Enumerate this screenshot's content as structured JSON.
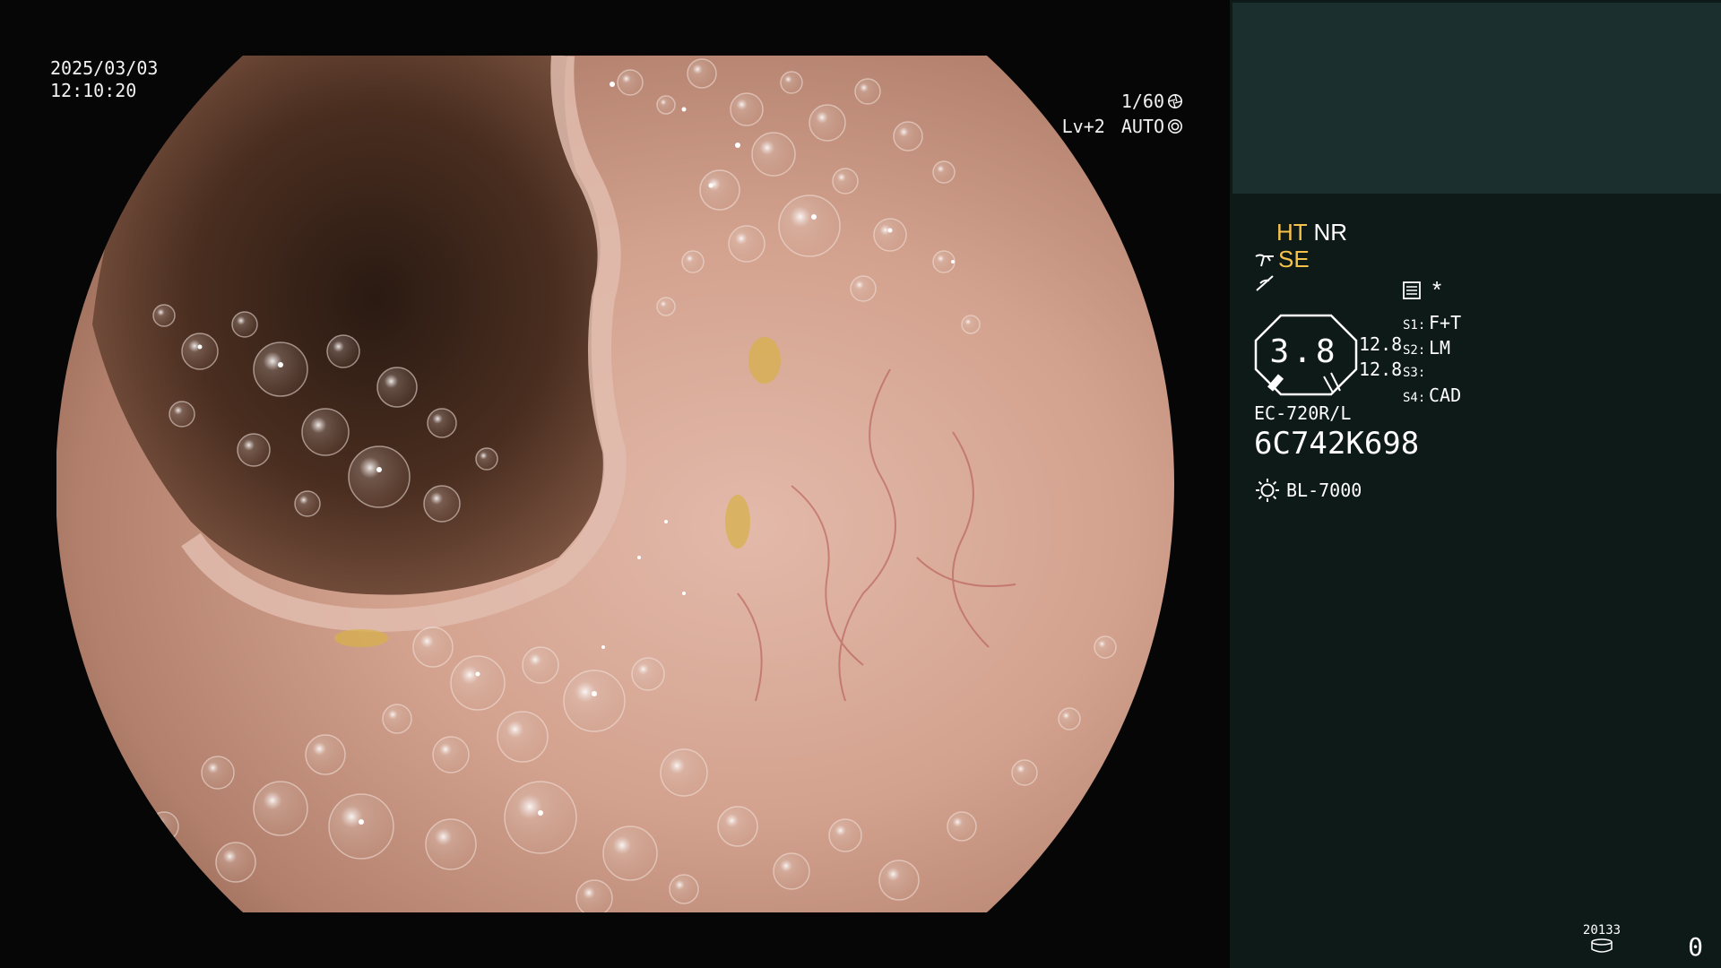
{
  "video": {
    "date": "2025/03/03",
    "time": "12:10:20",
    "shutter": "1/60",
    "shutter_icon": "shutter-icon",
    "level": "Lv+2",
    "exposure_mode": "AUTO",
    "exposure_icon": "iris-icon"
  },
  "panel": {
    "modes": {
      "ht": "HT",
      "nr": "NR"
    },
    "se": {
      "icon": "structure-enhancement-icon",
      "label": "SE"
    },
    "curve_icon": "tone-curve-icon",
    "memory_icon": "memory-card-icon",
    "asterisk": "*",
    "gauge": {
      "value": "3.8",
      "upper": "12.8",
      "lower": "12.8"
    },
    "settings": [
      {
        "key": "S1:",
        "value": "F+T"
      },
      {
        "key": "S2:",
        "value": "LM"
      },
      {
        "key": "S3:",
        "value": ""
      },
      {
        "key": "S4:",
        "value": "CAD"
      }
    ],
    "scope_model": "EC-720R/L",
    "serial": "6C742K698",
    "light_source": {
      "icon": "light-source-icon",
      "label": "BL-7000"
    },
    "counter": {
      "label": "20133",
      "icon": "storage-drum-icon",
      "count": "0"
    }
  },
  "colors": {
    "panel_bg": "#0e1a18",
    "panel_top": "#1b302e",
    "accent_yellow": "#f6c24a"
  }
}
